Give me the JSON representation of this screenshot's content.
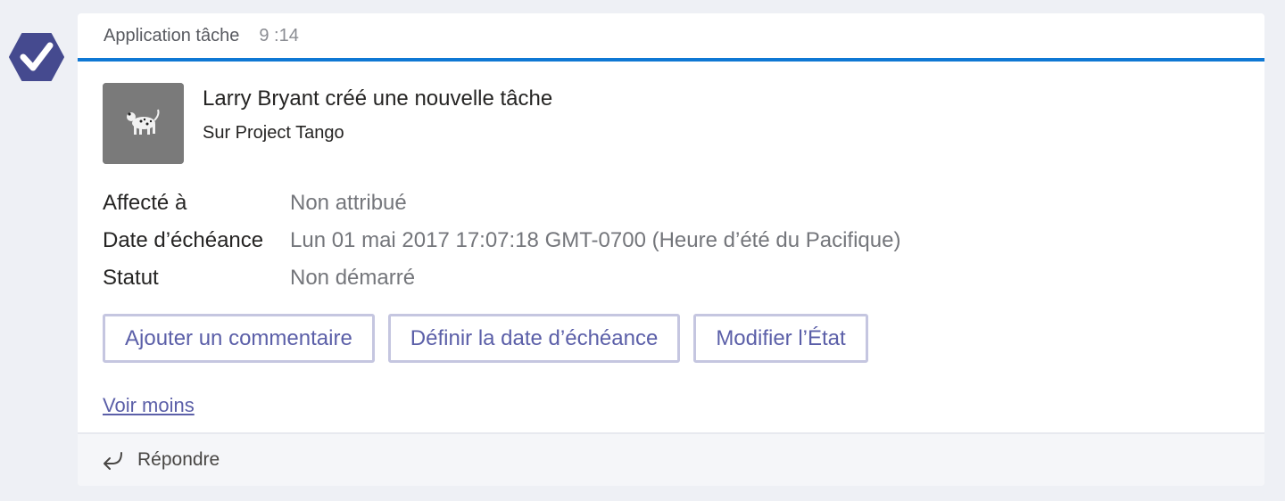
{
  "header": {
    "sender": "Application tâche",
    "time": "9 :14"
  },
  "colors": {
    "accent": "#0f78d4",
    "app_icon": "#454a8f",
    "button_text": "#5b5fa8",
    "button_border": "#c5c6e0"
  },
  "icons": {
    "app": "checkmark-hexagon-icon",
    "thumbnail": "dalmatian-dog-image",
    "reply": "reply-arrow-icon"
  },
  "card": {
    "title": "Larry Bryant créé une nouvelle tâche",
    "subtitle": "Sur Project Tango",
    "facts": [
      {
        "label": "Affecté à",
        "value": "Non attribué"
      },
      {
        "label": "Date d’échéance",
        "value": "Lun 01 mai 2017 17:07:18 GMT-0700 (Heure d’été du Pacifique)"
      },
      {
        "label": "Statut",
        "value": "Non démarré"
      }
    ],
    "actions": [
      {
        "label": "Ajouter un commentaire"
      },
      {
        "label": "Définir la date d’échéance"
      },
      {
        "label": "Modifier l’État"
      }
    ],
    "see_less": "Voir moins"
  },
  "reply": {
    "label": "Répondre"
  }
}
